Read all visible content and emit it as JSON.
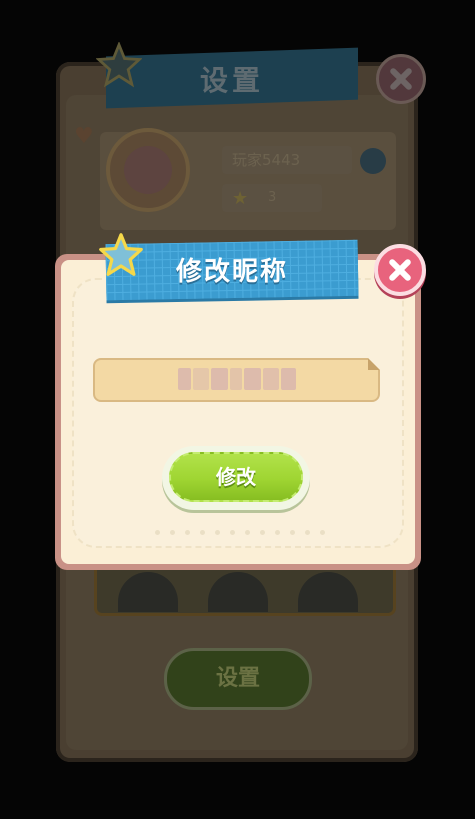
{
  "background_panel": {
    "title": "设置",
    "player_name": "玩家5443",
    "player_level": "3",
    "settings_button_label": "设置"
  },
  "modal": {
    "title": "修改昵称",
    "nickname_value": "",
    "confirm_label": "修改"
  },
  "colors": {
    "ribbon_blue": "#3b9cd0",
    "close_pink": "#e8637d",
    "confirm_green": "#9fd532",
    "paper": "#fbefd6",
    "frame": "#c99186"
  },
  "icons": [
    "star-icon",
    "close-icon",
    "edit-icon",
    "heart-icon"
  ]
}
